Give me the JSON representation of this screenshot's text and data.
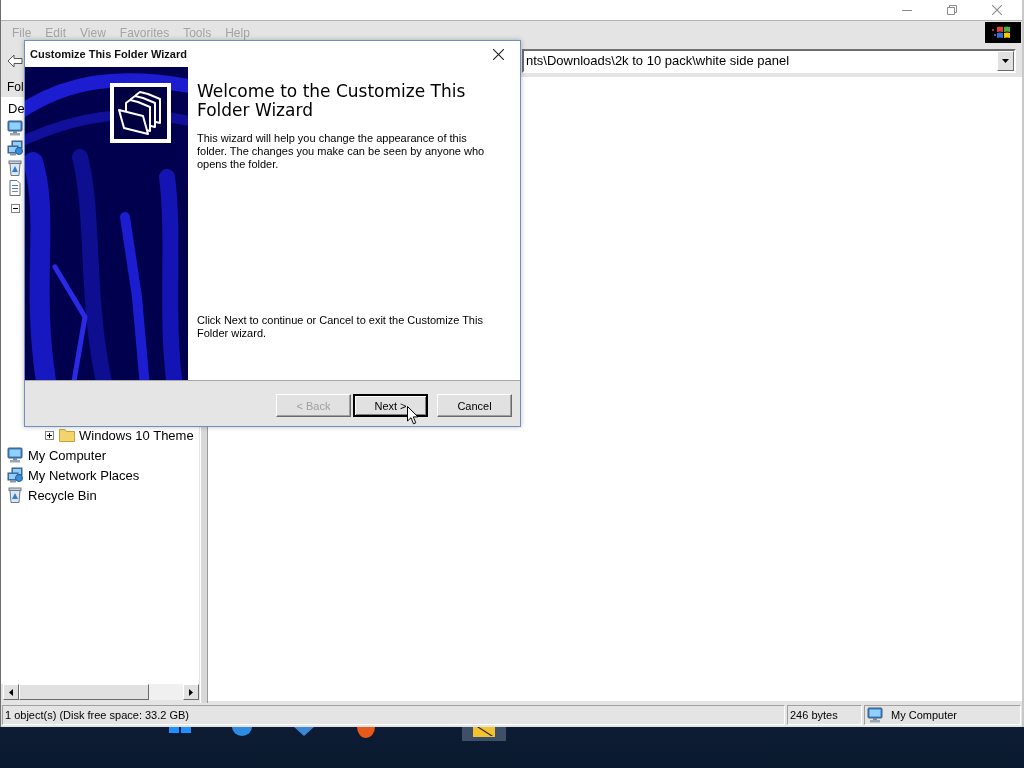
{
  "explorer": {
    "menu": [
      {
        "label": "File",
        "disabled": true
      },
      {
        "label": "Edit",
        "disabled": true
      },
      {
        "label": "View",
        "disabled": true
      },
      {
        "label": "Favorites",
        "disabled": true
      },
      {
        "label": "Tools",
        "disabled": true
      },
      {
        "label": "Help",
        "disabled": true
      }
    ],
    "address": {
      "value": "nts\\Downloads\\2k to 10 pack\\white side panel"
    },
    "left_pane": {
      "header": "Fol",
      "tree": [
        {
          "label": "De"
        },
        {
          "kind": "computer"
        },
        {
          "kind": "network"
        },
        {
          "kind": "recycle"
        },
        {
          "kind": "document"
        },
        {
          "expanded": true,
          "children": [
            {
              "kind": "folder",
              "label": "Windows 10 Theme",
              "expanded": false
            }
          ]
        },
        {
          "kind": "computer",
          "label": "My Computer"
        },
        {
          "kind": "network",
          "label": "My Network Places"
        },
        {
          "kind": "recycle",
          "label": "Recycle Bin"
        }
      ]
    },
    "status_bar": [
      {
        "text": "1 object(s) (Disk free space: 33.2 GB)"
      },
      {
        "text": "246 bytes"
      },
      {
        "kind": "computer",
        "text": "My Computer"
      }
    ]
  },
  "dialog": {
    "title": "Customize This Folder Wizard",
    "heading": "Welcome to the Customize This Folder Wizard",
    "intro": "This wizard will help you change the appearance of this folder. The changes you make can be seen by anyone who opens the folder.",
    "instruction": "Click Next to continue or Cancel to exit the Customize This Folder wizard.",
    "buttons": [
      {
        "label": "< Back",
        "disabled": true,
        "default": false
      },
      {
        "label": "Next >",
        "disabled": false,
        "default": true
      },
      {
        "label": "Cancel",
        "disabled": false,
        "default": false
      }
    ]
  },
  "taskbar": {
    "apps": [
      {
        "kind": "tiles",
        "selected": false
      },
      {
        "kind": "globe",
        "selected": false
      },
      {
        "kind": "arrow",
        "selected": false
      },
      {
        "kind": "orb",
        "selected": false
      },
      {
        "kind": "folder",
        "selected": true
      }
    ]
  }
}
